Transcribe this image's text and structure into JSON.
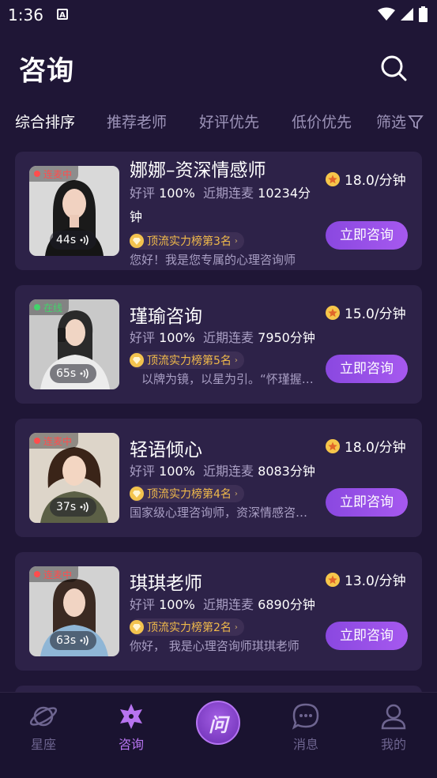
{
  "status_bar": {
    "time": "1:36"
  },
  "header": {
    "title": "咨询"
  },
  "tabs": [
    {
      "label": "综合排序",
      "active": true
    },
    {
      "label": "推荐老师",
      "active": false
    },
    {
      "label": "好评优先",
      "active": false
    },
    {
      "label": "低价优先",
      "active": false
    }
  ],
  "filter_label": "筛选",
  "cards": [
    {
      "name": "娜娜–资深情感师",
      "status": "连麦中",
      "status_color": "#ff4d4d",
      "voice": "44s",
      "rating_label": "好评",
      "rating": "100%",
      "calls_label": "近期连麦",
      "calls": "10234分钟",
      "rank": "顶流实力榜第3名",
      "intro": "您好！我是您专属的心理咨询师",
      "price": "18.0/分钟",
      "button": "立即咨询"
    },
    {
      "name": "瑾瑜咨询",
      "status": "在线",
      "status_color": "#43d36b",
      "voice": "65s",
      "rating_label": "好评",
      "rating": "100%",
      "calls_label": "近期连麦",
      "calls": "7950分钟",
      "rank": "顶流实力榜第5名",
      "intro": "　以牌为镜，以星为引。“怀瑾握瑜”",
      "price": "15.0/分钟",
      "button": "立即咨询"
    },
    {
      "name": "轻语倾心",
      "status": "连麦中",
      "status_color": "#ff4d4d",
      "voice": "37s",
      "rating_label": "好评",
      "rating": "100%",
      "calls_label": "近期连麦",
      "calls": "8083分钟",
      "rank": "顶流实力榜第4名",
      "intro": "国家级心理咨询师，资深情感咨询师",
      "price": "18.0/分钟",
      "button": "立即咨询"
    },
    {
      "name": "琪琪老师",
      "status": "连麦中",
      "status_color": "#ff4d4d",
      "voice": "63s",
      "rating_label": "好评",
      "rating": "100%",
      "calls_label": "近期连麦",
      "calls": "6890分钟",
      "rank": "顶流实力榜第2名",
      "intro": "你好， 我是心理咨询师琪琪老师",
      "price": "13.0/分钟",
      "button": "立即咨询"
    }
  ],
  "bottom_nav": {
    "items": [
      {
        "label": "星座",
        "icon": "planet-icon",
        "active": false
      },
      {
        "label": "咨询",
        "icon": "star-icon",
        "active": true
      },
      {
        "label": "消息",
        "icon": "chat-icon",
        "active": false
      },
      {
        "label": "我的",
        "icon": "person-icon",
        "active": false
      }
    ],
    "center_label": "问"
  },
  "colors": {
    "background": "#1f1636",
    "card": "#2d2248",
    "accent": "#a659ef",
    "gold": "#f0b94a"
  }
}
